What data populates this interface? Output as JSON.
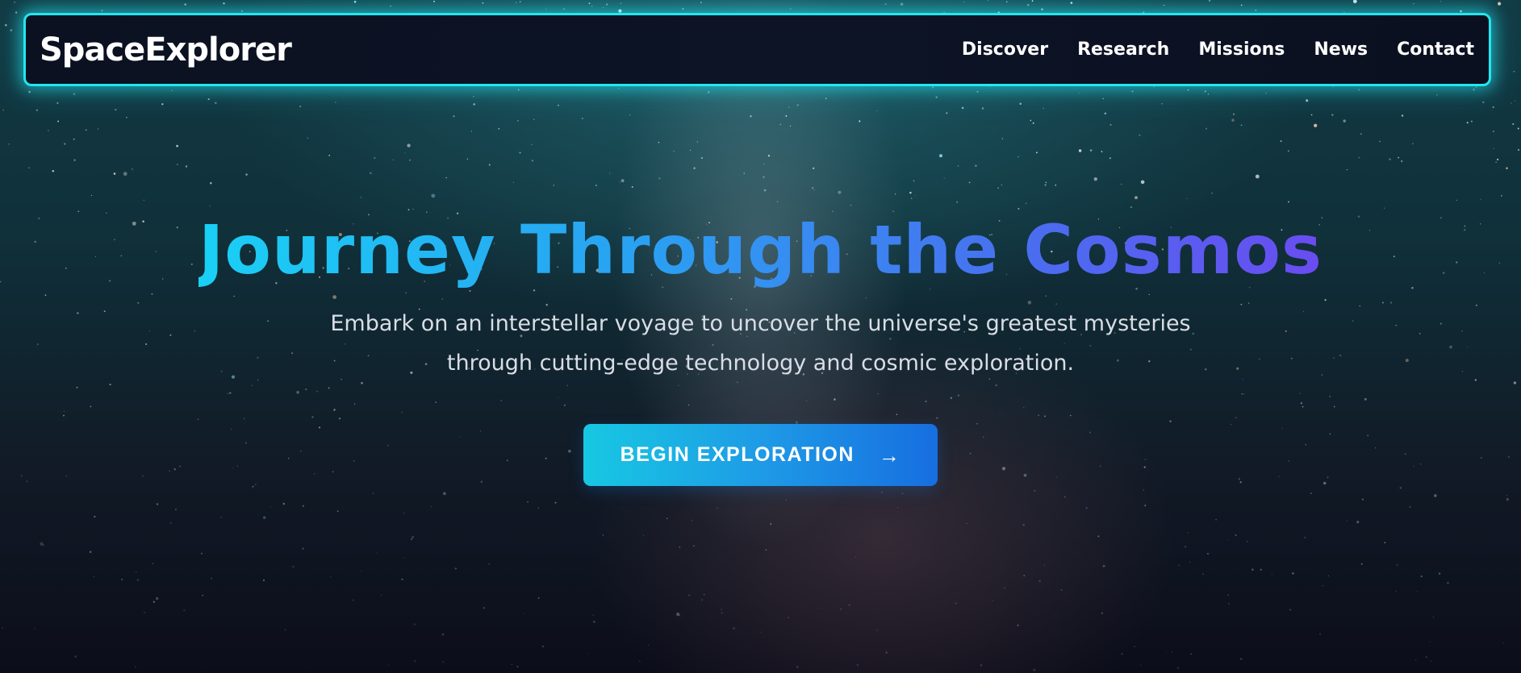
{
  "brand": {
    "name": "SpaceExplorer"
  },
  "nav": {
    "items": [
      {
        "label": "Discover"
      },
      {
        "label": "Research"
      },
      {
        "label": "Missions"
      },
      {
        "label": "News"
      },
      {
        "label": "Contact"
      }
    ]
  },
  "hero": {
    "title": "Journey Through the Cosmos",
    "subtitle": "Embark on an interstellar voyage to uncover the universe's greatest mysteries through cutting-edge technology and cosmic exploration.",
    "cta_label": "BEGIN EXPLORATION",
    "cta_icon": "arrow-right-icon"
  },
  "colors": {
    "accent_glow": "#22e6f0",
    "title_gradient_start": "#1ad0f5",
    "title_gradient_end": "#6a4cf0",
    "button_gradient_start": "#17c8e2",
    "button_gradient_end": "#176ee0"
  }
}
